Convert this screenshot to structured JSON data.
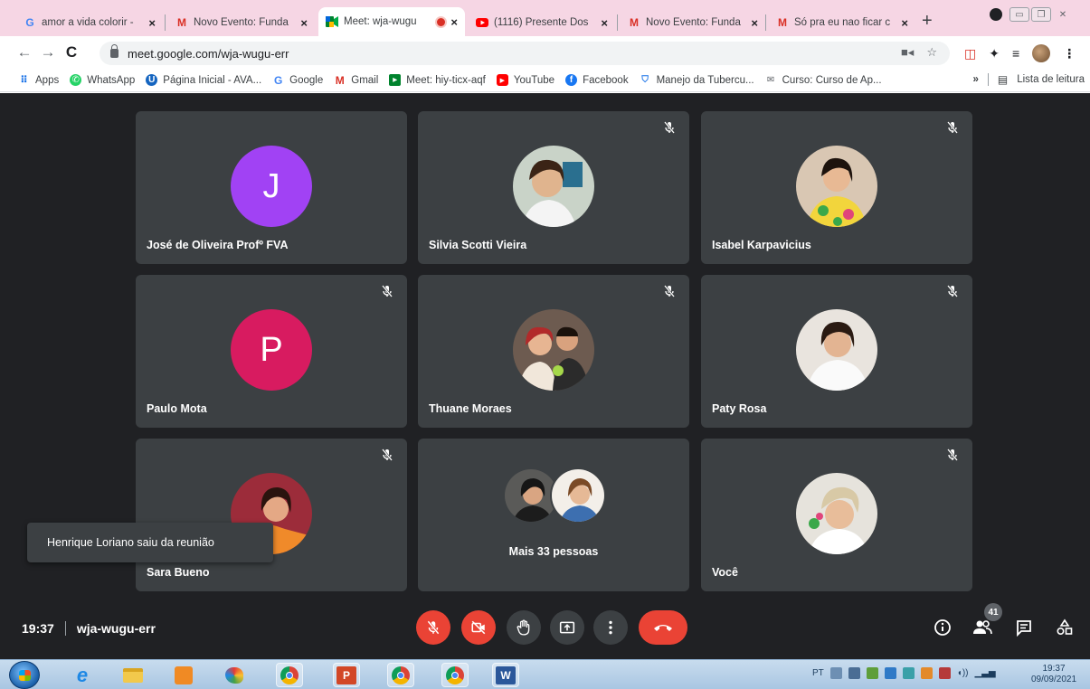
{
  "browser": {
    "tabs": [
      {
        "title": "amor a vida colorir -",
        "favicon": "google-icon",
        "active": false
      },
      {
        "title": "Novo Evento: Funda",
        "favicon": "gmail-icon",
        "active": false
      },
      {
        "title": "Meet: wja-wugu",
        "favicon": "meet-icon",
        "active": true,
        "recording": true
      },
      {
        "title": "(1116) Presente Dos",
        "favicon": "youtube-icon",
        "active": false
      },
      {
        "title": "Novo Evento: Funda",
        "favicon": "gmail-icon",
        "active": false
      },
      {
        "title": "Só pra eu nao ficar c",
        "favicon": "gmail-icon",
        "active": false
      }
    ],
    "tab_close": "×",
    "new_tab": "+",
    "url": "meet.google.com/wja-wugu-err",
    "bookmarks": [
      {
        "label": "Apps",
        "icon": "apps-grid-icon"
      },
      {
        "label": "WhatsApp",
        "icon": "whatsapp-icon"
      },
      {
        "label": "Página Inicial - AVA...",
        "icon": "ava-icon"
      },
      {
        "label": "Google",
        "icon": "google-icon"
      },
      {
        "label": "Gmail",
        "icon": "gmail-icon"
      },
      {
        "label": "Meet: hiy-ticx-aqf",
        "icon": "meet-icon"
      },
      {
        "label": "YouTube",
        "icon": "youtube-icon"
      },
      {
        "label": "Facebook",
        "icon": "facebook-icon"
      },
      {
        "label": "Manejo da Tubercu...",
        "icon": "shield-icon"
      },
      {
        "label": "Curso: Curso de Ap...",
        "icon": "mail-icon"
      }
    ],
    "bookmarks_more": "»",
    "reading_list": "Lista de leitura"
  },
  "meet": {
    "tiles": [
      {
        "name": "José de Oliveira Profº FVA",
        "avatar_type": "letter",
        "letter": "J",
        "avatar_color": "#a142f4",
        "muted": false
      },
      {
        "name": "Silvia Scotti Vieira",
        "avatar_type": "photo",
        "muted": true
      },
      {
        "name": "Isabel Karpavicius",
        "avatar_type": "photo",
        "muted": true
      },
      {
        "name": "Paulo Mota",
        "avatar_type": "letter",
        "letter": "P",
        "avatar_color": "#d81b60",
        "muted": true
      },
      {
        "name": "Thuane Moraes",
        "avatar_type": "photo",
        "muted": true
      },
      {
        "name": "Paty Rosa",
        "avatar_type": "photo",
        "muted": true
      },
      {
        "name": "Sara Bueno",
        "avatar_type": "photo",
        "muted": true
      },
      {
        "name": "Mais 33 pessoas",
        "avatar_type": "group",
        "muted": false
      },
      {
        "name": "Você",
        "avatar_type": "photo",
        "muted": true
      }
    ],
    "toast": "Henrique Loriano saiu da reunião",
    "time": "19:37",
    "meeting_code": "wja-wugu-err",
    "participant_count": "41",
    "controls": [
      "mic-off-icon",
      "camera-off-icon",
      "raise-hand-icon",
      "present-icon",
      "more-options-icon",
      "leave-call-icon"
    ],
    "right_controls": [
      "info-icon",
      "people-icon",
      "chat-icon",
      "activities-icon"
    ]
  },
  "taskbar": {
    "language": "PT",
    "clock_time": "19:37",
    "clock_date": "09/09/2021"
  }
}
